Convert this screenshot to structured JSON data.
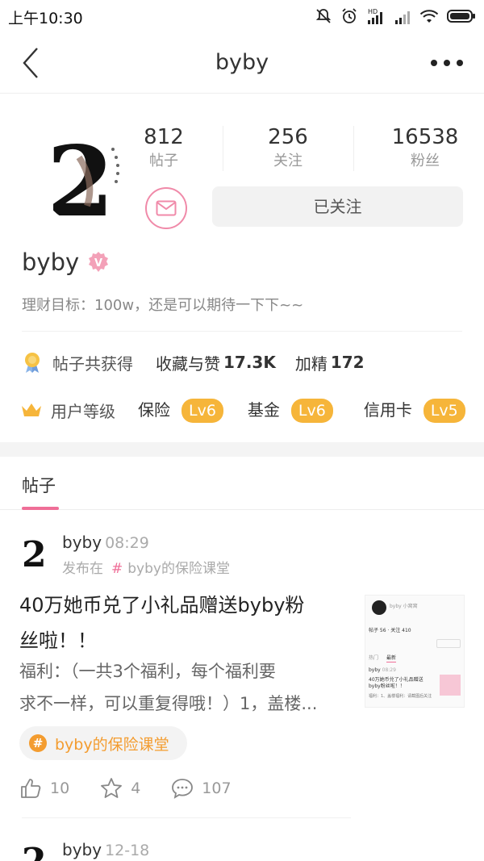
{
  "status": {
    "time": "上午10:30",
    "icons": [
      "notifications-off-icon",
      "alarm-icon",
      "hd-signal-icon",
      "signal-icon",
      "wifi-icon",
      "battery-icon"
    ],
    "hd_label": "HD"
  },
  "nav": {
    "title": "byby",
    "back_icon": "back-chevron-icon",
    "more_icon": "more-dots-icon"
  },
  "profile": {
    "avatar_glyph": "2",
    "stats": [
      {
        "num": "812",
        "label": "帖子"
      },
      {
        "num": "256",
        "label": "关注"
      },
      {
        "num": "16538",
        "label": "粉丝"
      }
    ],
    "follow_label": "已关注",
    "name": "byby",
    "verified_badge": "V",
    "bio": "理财目标：100w，还是可以期待一下下~~"
  },
  "achievements": {
    "prefix": "帖子共获得",
    "collect_label": "收藏与赞",
    "collect_value": "17.3K",
    "featured_label": "加精",
    "featured_value": "172"
  },
  "levels": {
    "title": "用户等级",
    "items": [
      {
        "label": "保险",
        "level": "Lv6"
      },
      {
        "label": "基金",
        "level": "Lv6"
      },
      {
        "label": "信用卡",
        "level": "Lv5"
      }
    ]
  },
  "tabs": {
    "posts": "帖子"
  },
  "posts": [
    {
      "author": "byby",
      "time": "08:29",
      "posted_in": "发布在",
      "hash": "#",
      "group": "byby的保险课堂",
      "title_lines": [
        "40万她币兑了小礼品赠送byby粉",
        "丝啦！！"
      ],
      "excerpt_lines": [
        "福利：（一共3个福利，每个福利要",
        "求不一样，可以重复得哦！）1，盖楼..."
      ],
      "tag": "byby的保险课堂",
      "tag_icon": "#",
      "likes": "10",
      "stars": "4",
      "comments": "107",
      "thumb": {
        "header_text": "byby 小窝窝",
        "stats": "帖子 56 · 关注 410",
        "tabs": [
          "热门",
          "最新"
        ],
        "author": "byby",
        "time": "08:29",
        "title": "40万她币兑了小礼品赠送byby粉丝啦！！",
        "excerpt": "福利：1、盖楼福利：请截图后关注"
      }
    },
    {
      "author": "byby",
      "time": "12-18"
    }
  ],
  "colors": {
    "accent_pink": "#ef6e97",
    "level_orange": "#f6b53a",
    "tag_orange": "#f39c2f"
  }
}
